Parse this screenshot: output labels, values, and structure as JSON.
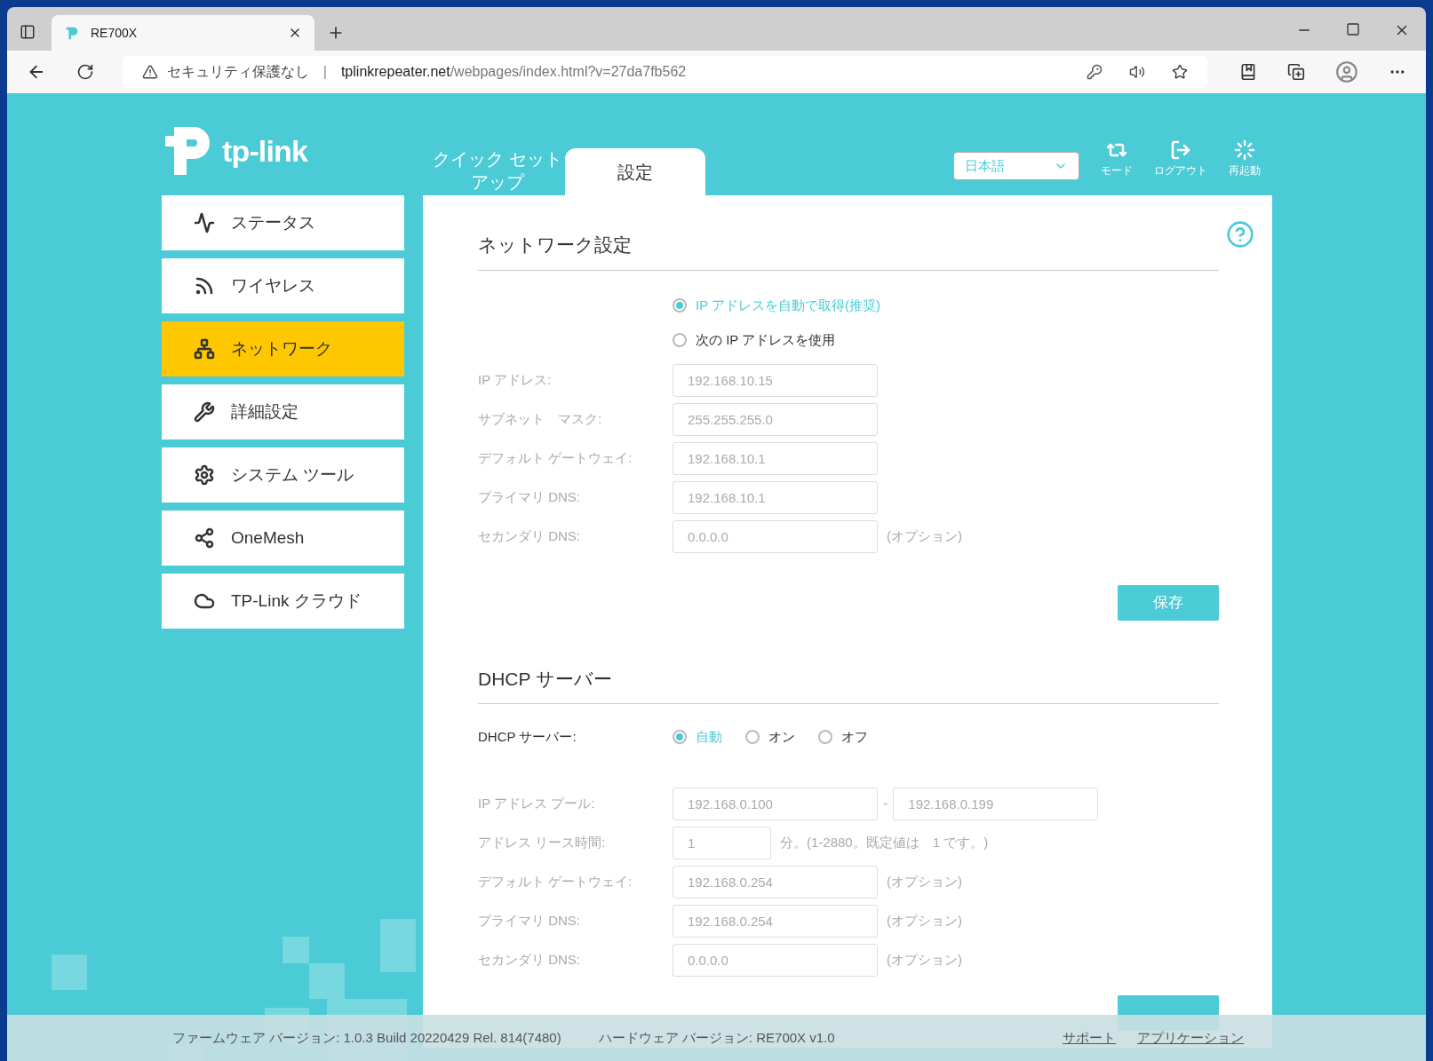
{
  "browser": {
    "tab_title": "RE700X",
    "security": "セキュリティ保護なし",
    "divider": "|",
    "url_host": "tplinkrepeater.net",
    "url_path": "/webpages/index.html?v=27da7fb562"
  },
  "header": {
    "logo": "tp-link",
    "tabs": [
      {
        "label": "クイック セットアップ",
        "selected": false
      },
      {
        "label": "設定",
        "selected": true
      }
    ],
    "language": "日本語",
    "actions": [
      {
        "kind": "mode",
        "label": "モード"
      },
      {
        "kind": "logout",
        "label": "ログアウト"
      },
      {
        "kind": "reboot",
        "label": "再起動"
      }
    ]
  },
  "sidebar": {
    "items": [
      {
        "kind": "status",
        "label": "ステータス",
        "selected": false
      },
      {
        "kind": "wireless",
        "label": "ワイヤレス",
        "selected": false
      },
      {
        "kind": "network",
        "label": "ネットワーク",
        "selected": true
      },
      {
        "kind": "advanced",
        "label": "詳細設定",
        "selected": false
      },
      {
        "kind": "system",
        "label": "システム ツール",
        "selected": false
      },
      {
        "kind": "mesh",
        "label": "OneMesh",
        "selected": false
      },
      {
        "kind": "cloud",
        "label": "TP-Link クラウド",
        "selected": false
      }
    ]
  },
  "network": {
    "title": "ネットワーク設定",
    "radios": [
      {
        "label": "IP アドレスを自動で取得(推奨)",
        "selected": true
      },
      {
        "label": "次の IP アドレスを使用",
        "selected": false
      }
    ],
    "fields": [
      {
        "label": "IP アドレス:",
        "value": "192.168.10.15",
        "disabled": true
      },
      {
        "label": "サブネット　マスク:",
        "value": "255.255.255.0",
        "disabled": true
      },
      {
        "label": "デフォルト ゲートウェイ:",
        "value": "192.168.10.1",
        "disabled": true
      },
      {
        "label": "プライマリ DNS:",
        "value": "192.168.10.1",
        "disabled": true
      },
      {
        "label": "セカンダリ DNS:",
        "value": "0.0.0.0",
        "disabled": true,
        "note": "(オプション)"
      }
    ],
    "save": "保存"
  },
  "dhcp": {
    "title": "DHCP サーバー",
    "server_label": "DHCP サーバー:",
    "radios": [
      {
        "label": "自動",
        "selected": true
      },
      {
        "label": "オン",
        "selected": false
      },
      {
        "label": "オフ",
        "selected": false
      }
    ],
    "pool": {
      "label": "IP アドレス プール:",
      "start": "192.168.0.100",
      "separator": "-",
      "end": "192.168.0.199",
      "disabled": true
    },
    "lease": {
      "label": "アドレス リース時間:",
      "value": "1",
      "note": "分。(1-2880。既定値は　1 です。)",
      "disabled": true
    },
    "fields": [
      {
        "label": "デフォルト ゲートウェイ:",
        "value": "192.168.0.254",
        "disabled": true,
        "note": "(オプション)"
      },
      {
        "label": "プライマリ DNS:",
        "value": "192.168.0.254",
        "disabled": true,
        "note": "(オプション)"
      },
      {
        "label": "セカンダリ DNS:",
        "value": "0.0.0.0",
        "disabled": true,
        "note": "(オプション)"
      }
    ]
  },
  "footer": {
    "firmware": "ファームウェア バージョン: 1.0.3 Build 20220429 Rel. 814(7480)",
    "hardware": "ハードウェア バージョン: RE700X v1.0",
    "links": [
      "サポート",
      "アプリケーション"
    ]
  }
}
